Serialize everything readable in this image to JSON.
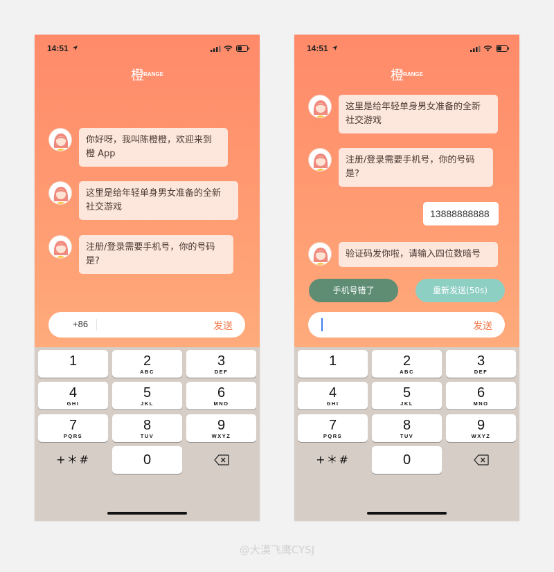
{
  "status_bar": {
    "time": "14:51"
  },
  "logo": {
    "main": "橙",
    "sub": "RANGE"
  },
  "left_screen": {
    "messages": [
      {
        "lines": [
          "你好呀，我叫陈橙橙，欢迎来到",
          "橙 App"
        ]
      },
      {
        "lines": [
          "这里是给年轻单身男女准备的全新",
          "社交游戏"
        ]
      },
      {
        "lines": [
          "注册/登录需要手机号，你的号码",
          "是?"
        ]
      }
    ],
    "input": {
      "country_code": "+86",
      "send_label": "发送"
    }
  },
  "right_screen": {
    "messages": [
      {
        "lines": [
          "这里是给年轻单身男女准备的全新",
          "社交游戏"
        ]
      },
      {
        "lines": [
          "注册/登录需要手机号，你的号码",
          "是?"
        ]
      }
    ],
    "user_reply": "13888888888",
    "verification_message": "验证码发你啦，请输入四位数暗号",
    "wrong_number_button": "手机号错了",
    "resend_button": "重新发送(50s)",
    "input": {
      "send_label": "发送"
    }
  },
  "keypad": {
    "keys": [
      {
        "num": "1",
        "letters": ""
      },
      {
        "num": "2",
        "letters": "ABC"
      },
      {
        "num": "3",
        "letters": "DEF"
      },
      {
        "num": "4",
        "letters": "GHI"
      },
      {
        "num": "5",
        "letters": "JKL"
      },
      {
        "num": "6",
        "letters": "MNO"
      },
      {
        "num": "7",
        "letters": "PQRS"
      },
      {
        "num": "8",
        "letters": "TUV"
      },
      {
        "num": "9",
        "letters": "WXYZ"
      }
    ],
    "symbols": "+＊#",
    "zero": "0"
  },
  "colors": {
    "gradient_top": "#ff8a6a",
    "gradient_bottom": "#ffab7c",
    "bubble": "#fde6db",
    "send": "#f47a4d",
    "wrong_button": "#5e8d74",
    "resend_button": "#8ecfc4",
    "keypad_bg": "#d6cdc6"
  },
  "watermark": "@大漠飞鹰CYSJ"
}
